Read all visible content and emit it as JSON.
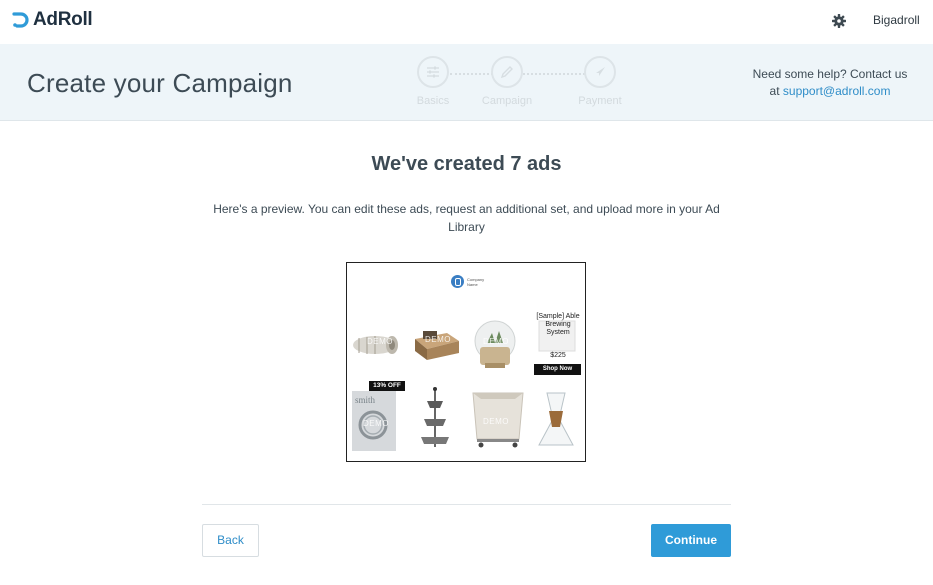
{
  "app": {
    "brand": "AdRoll",
    "username": "Bigadroll",
    "accent_color": "#2f9bd8"
  },
  "header": {
    "title": "Create your Campaign",
    "steps": [
      {
        "label": "Basics",
        "icon": "sliders-icon"
      },
      {
        "label": "Campaign",
        "icon": "pencil-icon"
      },
      {
        "label": "Payment",
        "icon": "rocket-icon"
      }
    ],
    "help_text": "Need some help? Contact us",
    "help_at": "at",
    "help_email": "support@adroll.com"
  },
  "main": {
    "heading": "We've created 7 ads",
    "description": "Here's a preview. You can edit these ads, request an additional set, and upload more in your Ad Library"
  },
  "preview": {
    "brand_name": "Company Name",
    "demo_label": "DEMO",
    "product_title": "[Sample] Able Brewing System",
    "price": "$225",
    "cta": "Shop Now",
    "discount": "13% OFF",
    "magazine_title": "smith"
  },
  "footer": {
    "back_label": "Back",
    "continue_label": "Continue"
  }
}
